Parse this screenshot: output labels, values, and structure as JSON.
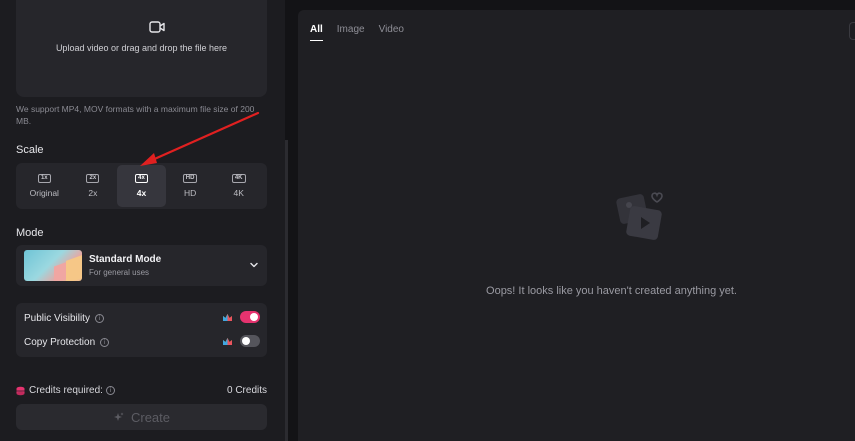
{
  "upload": {
    "text": "Upload video or drag and drop the file here",
    "support_text": "We support MP4, MOV formats with a maximum file size of 200 MB.",
    "icon": "video-camera-icon"
  },
  "scale": {
    "title": "Scale",
    "options": [
      {
        "badge": "1x",
        "label": "Original",
        "selected": false
      },
      {
        "badge": "2x",
        "label": "2x",
        "selected": false
      },
      {
        "badge": "4x",
        "label": "4x",
        "selected": true
      },
      {
        "badge": "HD",
        "label": "HD",
        "selected": false
      },
      {
        "badge": "4K",
        "label": "4K",
        "selected": false
      }
    ]
  },
  "mode": {
    "title": "Mode",
    "name": "Standard Mode",
    "description": "For general uses"
  },
  "toggles": {
    "public_visibility": {
      "label": "Public Visibility",
      "on": true
    },
    "copy_protection": {
      "label": "Copy Protection",
      "on": false
    }
  },
  "credits": {
    "label": "Credits required:",
    "value": "0 Credits"
  },
  "create_button": {
    "label": "Create",
    "enabled": false
  },
  "tabs": [
    {
      "label": "All",
      "active": true
    },
    {
      "label": "Image",
      "active": false
    },
    {
      "label": "Video",
      "active": false
    }
  ],
  "empty_state": {
    "message": "Oops! It looks like you haven't created anything yet."
  },
  "colors": {
    "accent": "#e5336f",
    "annotation_arrow": "#e02020",
    "panel_bg": "#1c1c20"
  }
}
